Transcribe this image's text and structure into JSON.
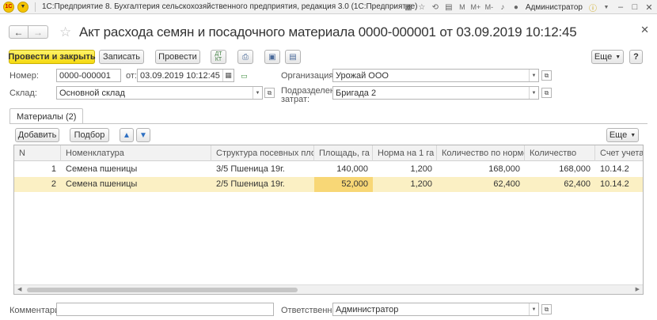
{
  "app": {
    "logo": "1С",
    "title": "1С:Предприятие 8. Бухгалтерия сельскохозяйственного предприятия, редакция 3.0  (1С:Предприятие)",
    "user": "Администратор",
    "icons": [
      "grid-icon",
      "star-icon",
      "history-icon",
      "calendar-icon",
      "m-icon",
      "m-plus-icon",
      "m-minus-icon",
      "bell-icon",
      "user-icon",
      "info-icon"
    ]
  },
  "document": {
    "title": "Акт расхода семян и посадочного материала 0000-000001 от 03.09.2019 10:12:45"
  },
  "toolbar": {
    "post_close": "Провести и закрыть",
    "save": "Записать",
    "post": "Провести",
    "more": "Еще"
  },
  "fields": {
    "number_label": "Номер:",
    "number_value": "0000-000001",
    "date_label": "от:",
    "date_value": "03.09.2019 10:12:45",
    "org_label": "Организация:",
    "org_value": "Урожай ООО",
    "warehouse_label": "Склад:",
    "warehouse_value": "Основной склад",
    "dept_label_1": "Подразделение",
    "dept_label_2": "затрат:",
    "dept_value": "Бригада 2",
    "comment_label": "Комментарий:",
    "comment_value": "",
    "responsible_label": "Ответственный:",
    "responsible_value": "Администратор"
  },
  "tabs": [
    {
      "label": "Материалы (2)"
    }
  ],
  "table_toolbar": {
    "add": "Добавить",
    "select": "Подбор",
    "more": "Еще"
  },
  "table": {
    "columns": [
      "N",
      "Номенклатура",
      "Структура посевных площа...",
      "Площадь, га",
      "Норма на 1 га",
      "Количество по норме",
      "Количество",
      "Счет учета"
    ],
    "rows": [
      {
        "n": "1",
        "item": "Семена пшеницы",
        "structure": "3/5 Пшеница 19г.",
        "area": "140,000",
        "norm": "1,200",
        "qty_norm": "168,000",
        "qty": "168,000",
        "account": "10.14.2"
      },
      {
        "n": "2",
        "item": "Семена пшеницы",
        "structure": "2/5 Пшеница 19г.",
        "area": "52,000",
        "norm": "1,200",
        "qty_norm": "62,400",
        "qty": "62,400",
        "account": "10.14.2"
      }
    ]
  }
}
